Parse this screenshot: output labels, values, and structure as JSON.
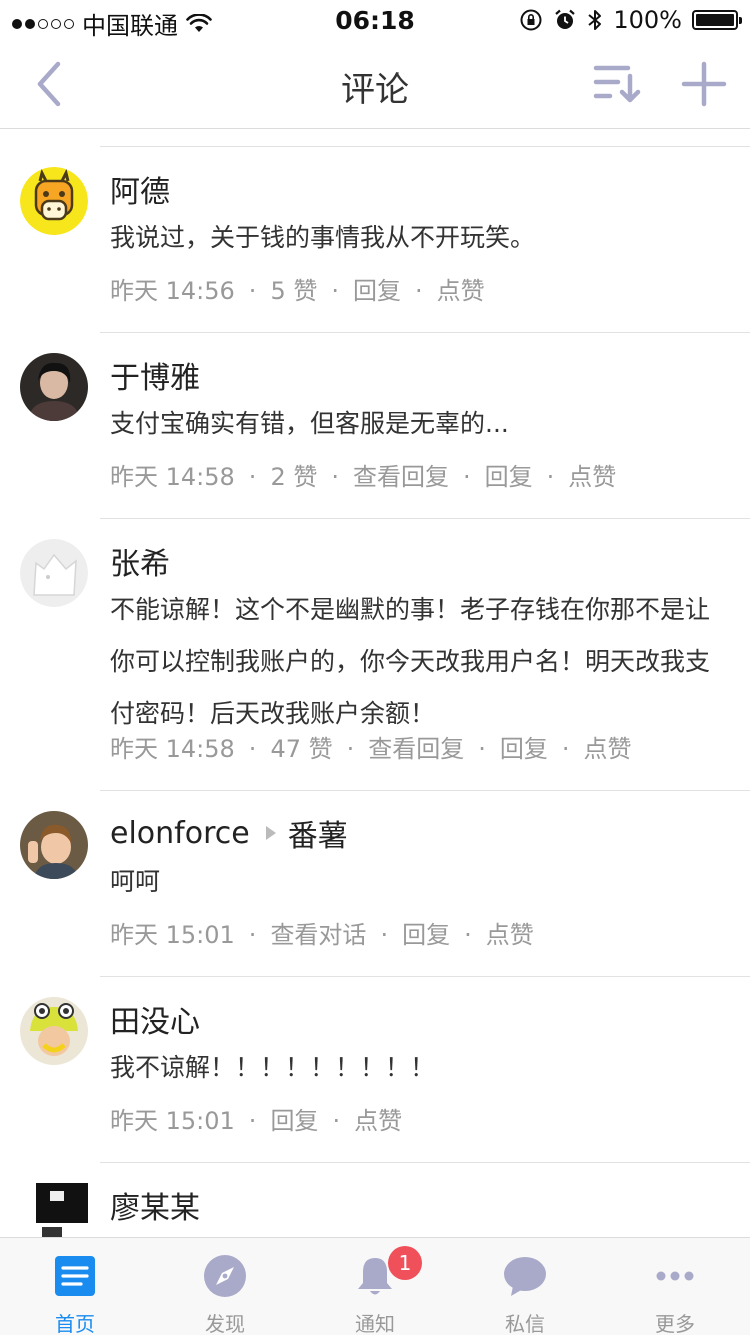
{
  "status_bar": {
    "carrier": "中国联通",
    "time": "06:18",
    "battery": "100%",
    "signal_bars_filled": 2,
    "signal_bars_total": 5,
    "battery_level": 1.0
  },
  "nav": {
    "title": "评论"
  },
  "comments": [
    {
      "author": "阿德",
      "reply_to": "",
      "text": "我说过，关于钱的事情我从不开玩笑。",
      "time": "昨天 14:56",
      "likes": "5 赞",
      "view_label": "",
      "reply": "回复",
      "like": "点赞"
    },
    {
      "author": "于博雅",
      "reply_to": "",
      "text": "支付宝确实有错，但客服是无辜的...",
      "time": "昨天 14:58",
      "likes": "2 赞",
      "view_label": "查看回复",
      "reply": "回复",
      "like": "点赞"
    },
    {
      "author": "张希",
      "reply_to": "",
      "text": "不能谅解！这个不是幽默的事！老子存钱在你那不是让你可以控制我账户的，你今天改我用户名！明天改我支付密码！后天改我账户余额！",
      "time": "昨天 14:58",
      "likes": "47 赞",
      "view_label": "查看回复",
      "reply": "回复",
      "like": "点赞"
    },
    {
      "author": "elonforce",
      "reply_to": "番薯",
      "text": "呵呵",
      "time": "昨天 15:01",
      "likes": "",
      "view_label": "查看对话",
      "reply": "回复",
      "like": "点赞"
    },
    {
      "author": "田没心",
      "reply_to": "",
      "text": "我不谅解！！！！！！！！！",
      "time": "昨天 15:01",
      "likes": "",
      "view_label": "",
      "reply": "回复",
      "like": "点赞"
    },
    {
      "author": "廖某某",
      "reply_to": "",
      "text": "",
      "time": "",
      "likes": "",
      "view_label": "",
      "reply": "",
      "like": ""
    }
  ],
  "tabs": [
    {
      "label": "首页",
      "icon": "home-list-icon",
      "active": true
    },
    {
      "label": "发现",
      "icon": "compass-icon",
      "active": false
    },
    {
      "label": "通知",
      "icon": "bell-icon",
      "active": false,
      "badge": "1"
    },
    {
      "label": "私信",
      "icon": "chat-bubble-icon",
      "active": false
    },
    {
      "label": "更多",
      "icon": "more-dots-icon",
      "active": false
    }
  ],
  "colors": {
    "accent": "#1a8cf0",
    "nav_icon": "#a9a9c9",
    "badge": "#f0505a",
    "meta_text": "#999999"
  }
}
